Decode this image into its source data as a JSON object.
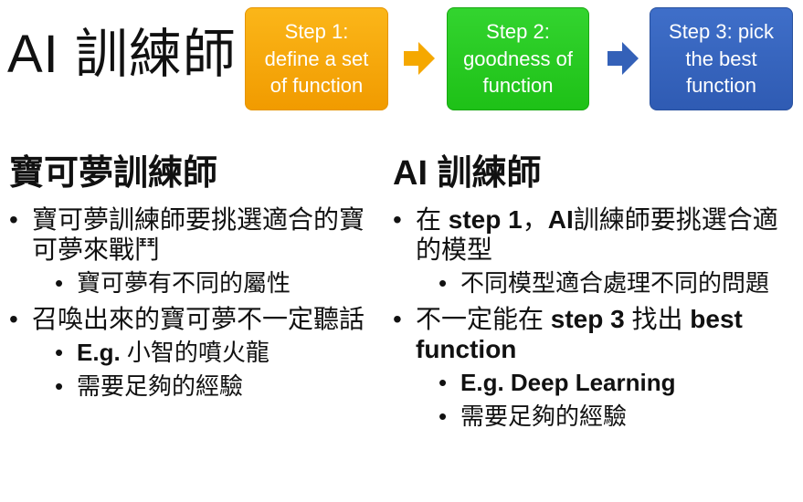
{
  "title": "AI 訓練師",
  "steps": [
    {
      "line1": "Step 1:",
      "line2": "define a set",
      "line3": "of function",
      "color": "#f5a800"
    },
    {
      "line1": "Step 2:",
      "line2": "goodness of",
      "line3": "function",
      "color": "#22c31b"
    },
    {
      "line1": "Step 3: pick",
      "line2": "the best",
      "line3": "function",
      "color": "#3461b8"
    }
  ],
  "arrows": [
    {
      "icon": "right-arrow-icon",
      "color": "#f5a800"
    },
    {
      "icon": "right-arrow-icon",
      "color": "#3461b8"
    }
  ],
  "bullet": "•",
  "left": {
    "heading": "寶可夢訓練師",
    "b1": "寶可夢訓練師要挑選適合的寶可夢來戰鬥",
    "b1_sub": "寶可夢有不同的屬性",
    "b2": "召喚出來的寶可夢不一定聽話",
    "b2_sub1_bold": "E.g.",
    "b2_sub1_rest": " 小智的噴火龍",
    "b2_sub2": "需要足夠的經驗"
  },
  "right": {
    "heading": "AI 訓練師",
    "b1_pre": "在 ",
    "b1_bold": "step 1",
    "b1_mid": "，",
    "b1_bold2": "AI",
    "b1_post": "訓練師要挑選合適的模型",
    "b1_sub": "不同模型適合處理不同的問題",
    "b2_pre": "不一定能在 ",
    "b2_bold": "step 3",
    "b2_mid": " 找出 ",
    "b2_bold2": "best function",
    "b2_sub1": "E.g. Deep Learning",
    "b2_sub2": "需要足夠的經驗"
  }
}
